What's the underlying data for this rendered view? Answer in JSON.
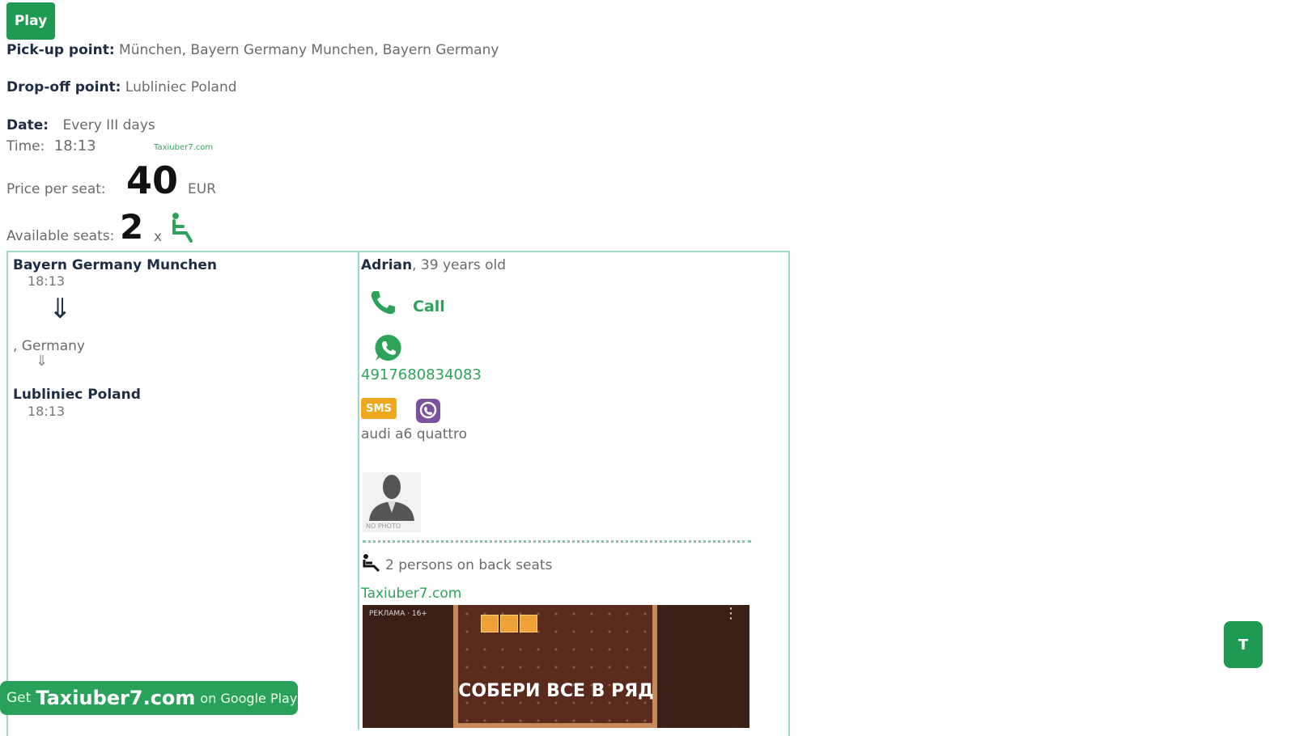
{
  "play_label": "Play",
  "pickup": {
    "label": "Pick-up point:",
    "value": "München, Bayern Germany Munchen, Bayern Germany"
  },
  "dropoff": {
    "label": "Drop-off point:",
    "value": "Lubliniec Poland"
  },
  "date": {
    "label": "Date:",
    "value": "Every III days"
  },
  "time": {
    "label": "Time:",
    "value": "18:13"
  },
  "watermark": "Taxiuber7.com",
  "price": {
    "label": "Price per seat:",
    "amount": "40",
    "currency": "EUR"
  },
  "seats": {
    "label": "Available seats:",
    "count": "2",
    "times": "x"
  },
  "route": {
    "from_city": "Bayern Germany Munchen",
    "from_time": "18:13",
    "arrow": "⇓",
    "mid_stop": ", Germany",
    "mid_arrow": "⇓",
    "to_city": "Lubliniec Poland",
    "to_time": "18:13"
  },
  "driver": {
    "name": "Adrian",
    "age": ", 39 years old",
    "call_label": "Call",
    "phone": "4917680834083",
    "sms_label": "SMS",
    "car": "audi a6 quattro",
    "no_photo": "NO PHOTO",
    "back_seats": "2 persons on back seats",
    "site_link": "Taxiuber7.com"
  },
  "ad": {
    "label": "РЕКЛАМА · 16+",
    "title": "СОБЕРИ ВСЕ В РЯД"
  },
  "banner": {
    "get": "Get",
    "brand": "Taxiuber7.com",
    "store": "on Google Play"
  },
  "top_label": "T",
  "colors": {
    "accent_green": "#1f9a52",
    "panel_border": "#9fd8c4",
    "sms_orange": "#f0a81e",
    "viber_purple": "#7b519d"
  }
}
